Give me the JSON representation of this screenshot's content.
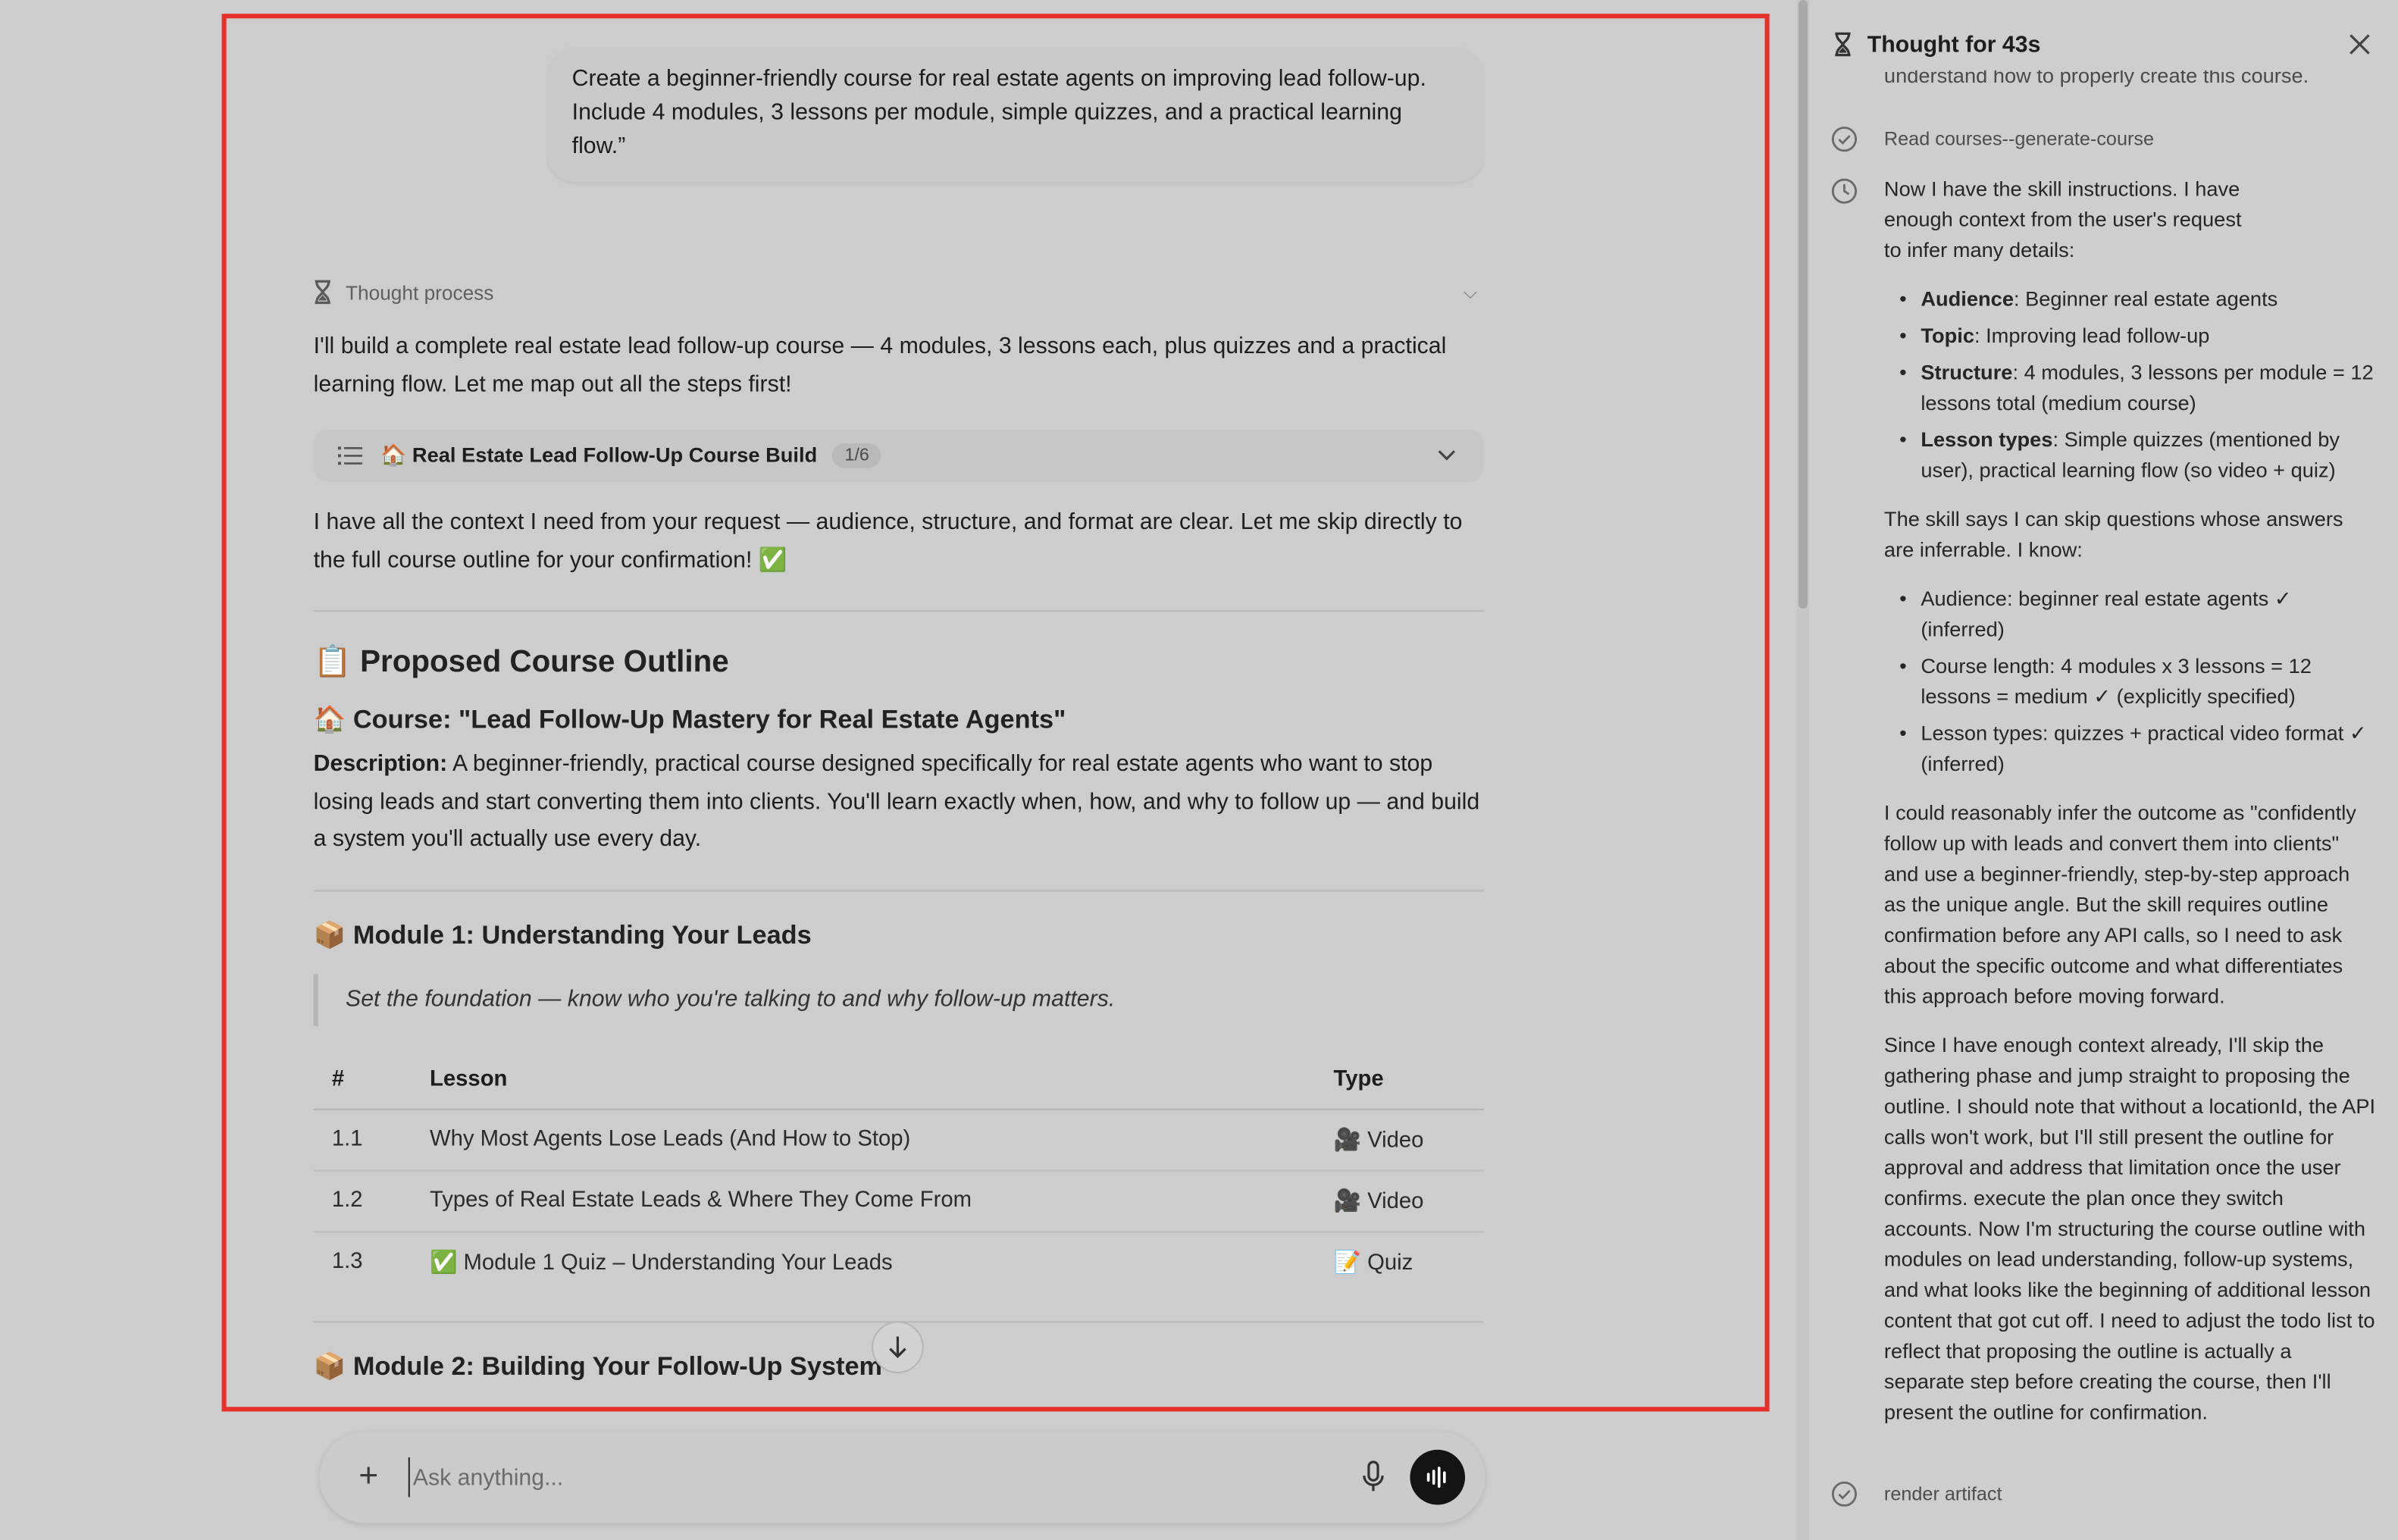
{
  "user_message": "Create a beginner-friendly course for real estate agents on improving lead follow-up. Include 4 modules, 3 lessons per module, simple quizzes, and a practical learning flow.”",
  "thought_process_label": "Thought process",
  "intro_text": "I'll build a complete real estate lead follow-up course — 4 modules, 3 lessons each, plus quizzes and a practical learning flow. Let me map out all the steps first!",
  "todo": {
    "title": "🏠 Real Estate Lead Follow-Up Course Build",
    "progress": "1/6"
  },
  "context_text": "I have all the context I need from your request — audience, structure, and format are clear. Let me skip directly to the full course outline for your confirmation! ✅",
  "outline_heading": "📋 Proposed Course Outline",
  "course_title": "🏠 Course: \"Lead Follow-Up Mastery for Real Estate Agents\"",
  "description_label": "Description:",
  "description_text": " A beginner-friendly, practical course designed specifically for real estate agents who want to stop losing leads and start converting them into clients. You'll learn exactly when, how, and why to follow up — and build a system you'll actually use every day.",
  "module1": {
    "title": "📦 Module 1: Understanding Your Leads",
    "quote": "Set the foundation — know who you're talking to and why follow-up matters.",
    "headers": [
      "#",
      "Lesson",
      "Type"
    ],
    "rows": [
      {
        "num": "1.1",
        "lesson": "Why Most Agents Lose Leads (And How to Stop)",
        "type": "🎥 Video"
      },
      {
        "num": "1.2",
        "lesson": "Types of Real Estate Leads & Where They Come From",
        "type": "🎥 Video"
      },
      {
        "num": "1.3",
        "lesson": "✅ Module 1 Quiz – Understanding Your Leads",
        "type": "📝 Quiz"
      }
    ]
  },
  "module2_title": "📦 Module 2: Building Your Follow-Up System",
  "composer": {
    "placeholder": "Ask anything..."
  },
  "side_panel": {
    "title": "Thought for 43s",
    "cut_text": "understand how to properly create this course.",
    "step_read": "Read courses--generate-course",
    "para1": "Now I have the skill instructions. I have enough context from the user's request to infer many details:",
    "bullets1": [
      {
        "label": "Audience",
        "text": ": Beginner real estate agents"
      },
      {
        "label": "Topic",
        "text": ": Improving lead follow-up"
      },
      {
        "label": "Structure",
        "text": ": 4 modules, 3 lessons per module = 12 lessons total (medium course)"
      },
      {
        "label": "Lesson types",
        "text": ": Simple quizzes (mentioned by user), practical learning flow (so video + quiz)"
      }
    ],
    "para2": "The skill says I can skip questions whose answers are inferrable. I know:",
    "bullets2": [
      "Audience: beginner real estate agents ✓ (inferred)",
      "Course length: 4 modules x 3 lessons = 12 lessons = medium ✓ (explicitly specified)",
      "Lesson types: quizzes + practical video format ✓ (inferred)"
    ],
    "para3": "I could reasonably infer the outcome as \"confidently follow up with leads and convert them into clients\" and use a beginner-friendly, step-by-step approach as the unique angle. But the skill requires outline confirmation before any API calls, so I need to ask about the specific outcome and what differentiates this approach before moving forward.",
    "para4": "Since I have enough context already, I'll skip the gathering phase and jump straight to proposing the outline. I should note that without a locationId, the API calls won't work, but I'll still present the outline for approval and address that limitation once the user confirms. execute the plan once they switch accounts. Now I'm structuring the course outline with modules on lead understanding, follow-up systems, and what looks like the beginning of additional lesson content that got cut off. I need to adjust the todo list to reflect that proposing the outline is actually a separate step before creating the course, then I'll present the outline for confirmation.",
    "step_render": "render artifact"
  }
}
